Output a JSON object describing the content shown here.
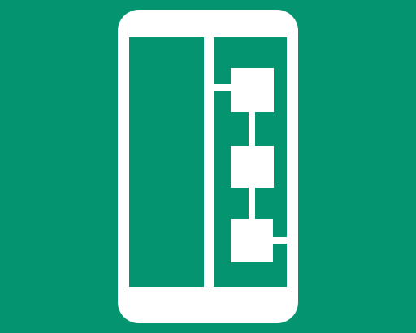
{
  "app_icon": {
    "icon": "phone-flowchart-icon",
    "colors": {
      "background": "#04946F",
      "foreground": "#FFFFFF"
    }
  }
}
